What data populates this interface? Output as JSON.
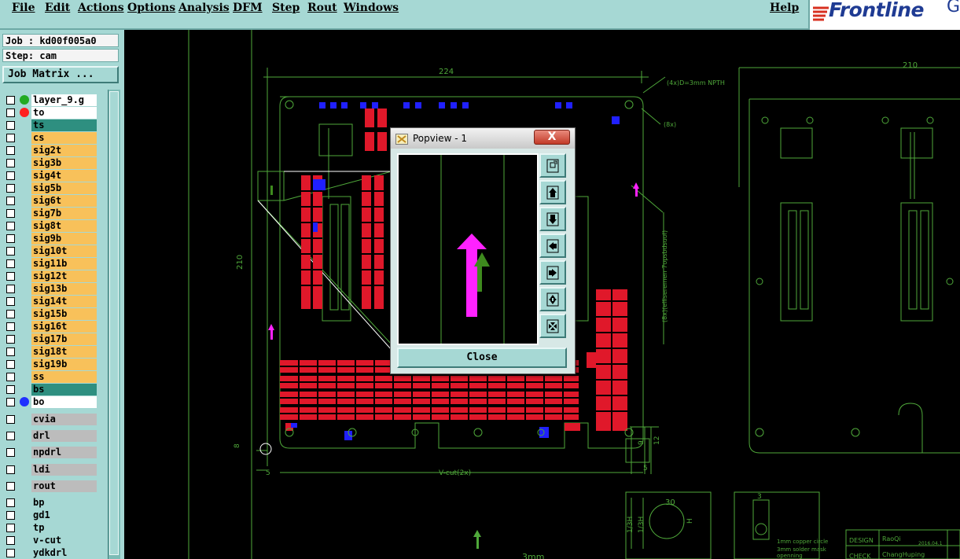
{
  "menu": {
    "file": "File",
    "edit": "Edit",
    "actions": "Actions",
    "options": "Options",
    "analysis": "Analysis",
    "dfm": "DFM",
    "step": "Step",
    "rout": "Rout",
    "windows": "Windows",
    "help": "Help"
  },
  "logo": {
    "text": "Frontline",
    "suffix": "Ge",
    "color": "#1f3b93"
  },
  "job_info": {
    "job": "Job : kd00f005a0",
    "step": "Step: cam"
  },
  "job_matrix_label": "Job Matrix ...",
  "layers": [
    {
      "name": "layer_9.g",
      "bg": "#ffffff",
      "dot": "#22aa22"
    },
    {
      "name": "to",
      "bg": "#ffffff",
      "dot": "#ff2020"
    },
    {
      "name": "ts",
      "bg": "#2e8f80"
    },
    {
      "name": "cs",
      "bg": "#f8c15a"
    },
    {
      "name": "sig2t",
      "bg": "#f8c15a"
    },
    {
      "name": "sig3b",
      "bg": "#f8c15a"
    },
    {
      "name": "sig4t",
      "bg": "#f8c15a"
    },
    {
      "name": "sig5b",
      "bg": "#f8c15a"
    },
    {
      "name": "sig6t",
      "bg": "#f8c15a"
    },
    {
      "name": "sig7b",
      "bg": "#f8c15a"
    },
    {
      "name": "sig8t",
      "bg": "#f8c15a"
    },
    {
      "name": "sig9b",
      "bg": "#f8c15a"
    },
    {
      "name": "sig10t",
      "bg": "#f8c15a"
    },
    {
      "name": "sig11b",
      "bg": "#f8c15a"
    },
    {
      "name": "sig12t",
      "bg": "#f8c15a"
    },
    {
      "name": "sig13b",
      "bg": "#f8c15a"
    },
    {
      "name": "sig14t",
      "bg": "#f8c15a"
    },
    {
      "name": "sig15b",
      "bg": "#f8c15a"
    },
    {
      "name": "sig16t",
      "bg": "#f8c15a"
    },
    {
      "name": "sig17b",
      "bg": "#f8c15a"
    },
    {
      "name": "sig18t",
      "bg": "#f8c15a"
    },
    {
      "name": "sig19b",
      "bg": "#f8c15a"
    },
    {
      "name": "ss",
      "bg": "#f8c15a"
    },
    {
      "name": "bs",
      "bg": "#2e8f80"
    },
    {
      "name": "bo",
      "bg": "#ffffff",
      "dot": "#2030ff"
    },
    {
      "name": "cvia",
      "bg": "#bcbcbc"
    },
    {
      "name": "drl",
      "bg": "#bcbcbc"
    },
    {
      "name": "npdrl",
      "bg": "#bcbcbc"
    },
    {
      "name": "ldi",
      "bg": "#bcbcbc"
    },
    {
      "name": "rout",
      "bg": "#bcbcbc"
    },
    {
      "name": "bp",
      "bg": "#a6d8d4"
    },
    {
      "name": "gd1",
      "bg": "#a6d8d4"
    },
    {
      "name": "tp",
      "bg": "#a6d8d4"
    },
    {
      "name": "v-cut",
      "bg": "#a6d8d4"
    },
    {
      "name": "ydkdrl",
      "bg": "#a6d8d4"
    }
  ],
  "drawing": {
    "dim_width": "224",
    "dim_height": "210",
    "dim_right_width": "210",
    "note_npth": "(4x)D=3mm NPTH",
    "note_8x": "(8x)",
    "note_v_cut": "V-cut(2x)",
    "note_vertical": "(8x)(elliseremen 7opsbdsuol)",
    "small_dim_8": "8",
    "small_dim_9": "9",
    "small_dim_12": "12",
    "small_dim_5": "5",
    "small_dim_3": "3",
    "detail1_dims": [
      "1/3H",
      "1/3H",
      "30",
      "H"
    ],
    "detail2_dim": "3",
    "detail2_note1": "1mm copper circle",
    "detail2_note2": "3mm solder mask",
    "detail2_note3": "openning",
    "bottom_label": "3mm",
    "title_block": {
      "design_label": "DESIGN",
      "design_value": "RaoQi",
      "check_label": "CHECK",
      "check_value": "ChangHuping",
      "date": "2016.04.1"
    }
  },
  "popup": {
    "title": "Popview - 1",
    "close_label": "Close",
    "x_label": "X"
  },
  "colors": {
    "panel": "#a6d8d4",
    "outline": "#4fa83a",
    "pad_red": "#e0182a",
    "pad_blue": "#2020ff",
    "arrow_magenta": "#ff22ff",
    "arrow_green": "#3e8a1e"
  }
}
